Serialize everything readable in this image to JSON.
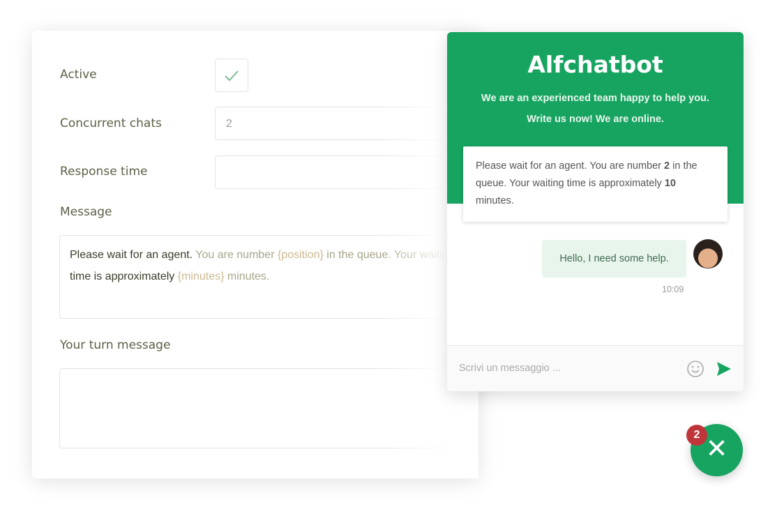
{
  "settings": {
    "active_label": "Active",
    "active_checked": true,
    "concurrent_label": "Concurrent chats",
    "concurrent_value": "2",
    "response_label": "Response time",
    "response_value": "",
    "message_label": "Message",
    "message_parts": [
      "Please wait for an agent.",
      " You are number ",
      "{position}",
      " in the queue. Your waiting",
      "time is approximately ",
      "{minutes}",
      " minutes."
    ],
    "turn_label": "Your turn message",
    "turn_value": ""
  },
  "chat": {
    "title": "Alfchatbot",
    "subtitle1": "We are an experienced team happy to help you.",
    "subtitle2": "Write us now! We are online.",
    "notice_parts": [
      "Please wait for an agent. You are number ",
      "2",
      " in the queue. Your waiting time is approximately ",
      "10",
      " minutes."
    ],
    "user_message": "Hello, I need some help.",
    "user_time": "10:09",
    "input_placeholder": "Scrivi un messaggio ...",
    "brand_color": "#17a461"
  },
  "fab": {
    "badge": "2",
    "icon": "close-icon"
  }
}
